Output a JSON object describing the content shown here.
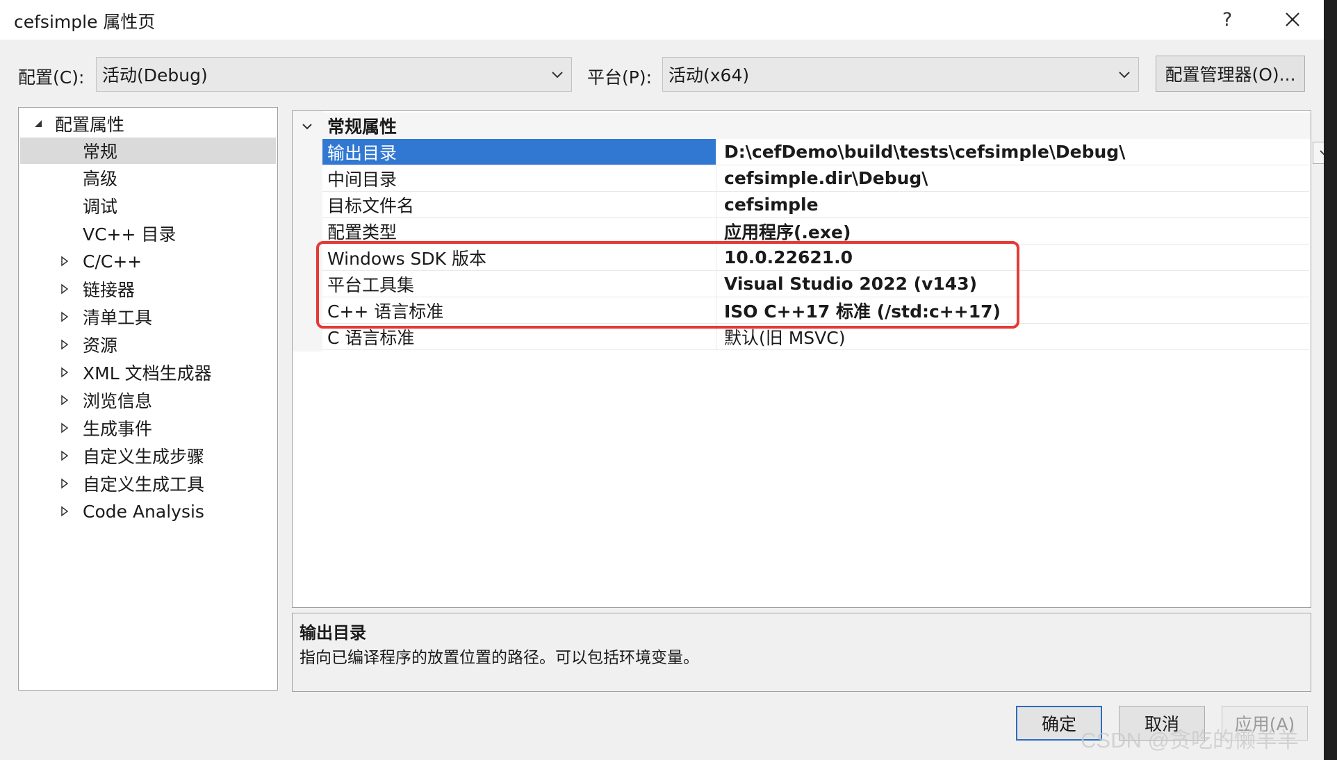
{
  "window": {
    "title": "cefsimple 属性页",
    "help_label": "?"
  },
  "config_bar": {
    "config_label": "配置(C):",
    "config_value": "活动(Debug)",
    "platform_label": "平台(P):",
    "platform_value": "活动(x64)",
    "manager_button": "配置管理器(O)..."
  },
  "tree": {
    "root": "配置属性",
    "items": [
      {
        "label": "常规"
      },
      {
        "label": "高级"
      },
      {
        "label": "调试"
      },
      {
        "label": "VC++ 目录"
      },
      {
        "label": "C/C++"
      },
      {
        "label": "链接器"
      },
      {
        "label": "清单工具"
      },
      {
        "label": "资源"
      },
      {
        "label": "XML 文档生成器"
      },
      {
        "label": "浏览信息"
      },
      {
        "label": "生成事件"
      },
      {
        "label": "自定义生成步骤"
      },
      {
        "label": "自定义生成工具"
      },
      {
        "label": "Code Analysis"
      }
    ]
  },
  "grid": {
    "category": "常规属性",
    "rows": [
      {
        "name": "输出目录",
        "value": "D:\\cefDemo\\build\\tests\\cefsimple\\Debug\\"
      },
      {
        "name": "中间目录",
        "value": "cefsimple.dir\\Debug\\"
      },
      {
        "name": "目标文件名",
        "value": "cefsimple"
      },
      {
        "name": "配置类型",
        "value": "应用程序(.exe)"
      },
      {
        "name": "Windows SDK 版本",
        "value": "10.0.22621.0"
      },
      {
        "name": "平台工具集",
        "value": "Visual Studio 2022 (v143)"
      },
      {
        "name": "C++ 语言标准",
        "value": "ISO C++17 标准 (/std:c++17)"
      },
      {
        "name": "C 语言标准",
        "value": "默认(旧 MSVC)"
      }
    ]
  },
  "description": {
    "title": "输出目录",
    "text": "指向已编译程序的放置位置的路径。可以包括环境变量。"
  },
  "buttons": {
    "ok": "确定",
    "cancel": "取消",
    "apply": "应用(A)"
  },
  "watermark": "CSDN @贪吃的懒羊羊",
  "colors": {
    "selection": "#3178d2",
    "highlight": "#e53935",
    "ok_border": "#2b6cc0"
  }
}
